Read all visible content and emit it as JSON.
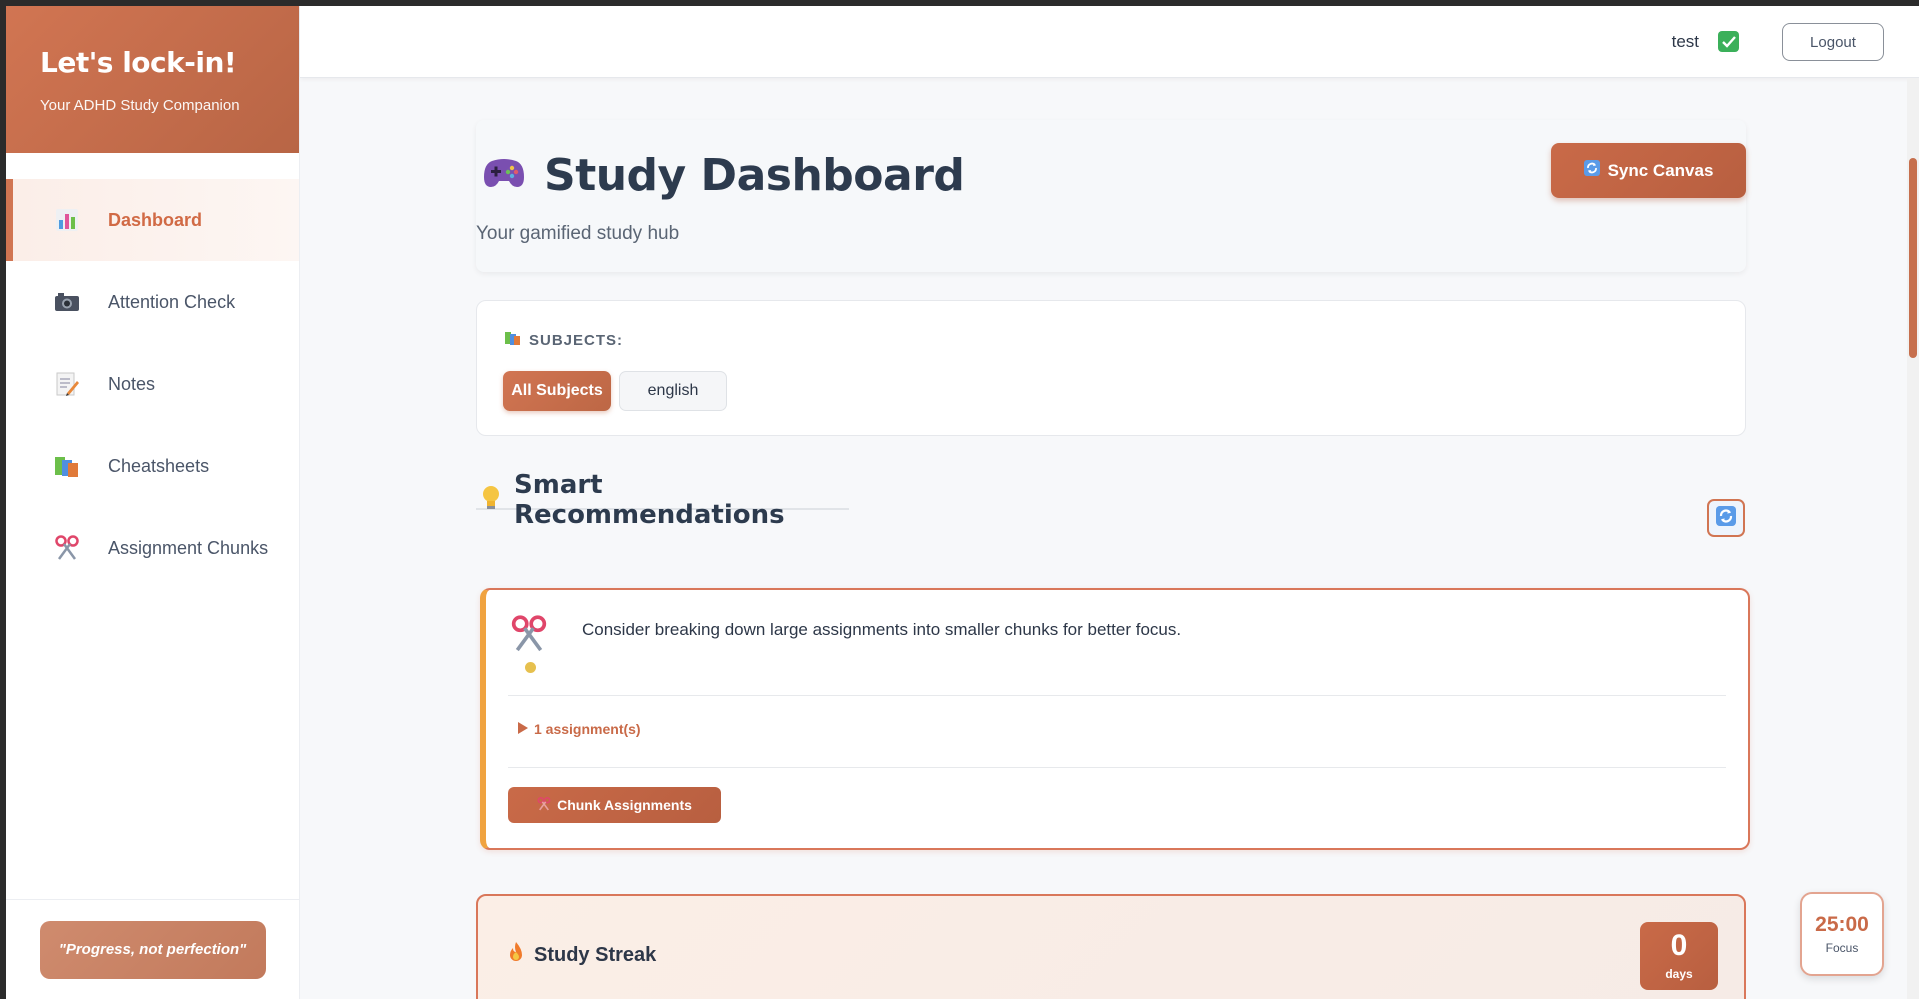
{
  "brand": {
    "title": "Let's lock-in!",
    "subtitle": "Your ADHD Study Companion"
  },
  "sidebar": {
    "items": [
      {
        "label": "Dashboard",
        "icon": "bar-chart-icon",
        "active": true
      },
      {
        "label": "Attention Check",
        "icon": "camera-icon",
        "active": false
      },
      {
        "label": "Notes",
        "icon": "memo-icon",
        "active": false
      },
      {
        "label": "Cheatsheets",
        "icon": "books-icon",
        "active": false
      },
      {
        "label": "Assignment Chunks",
        "icon": "scissors-icon",
        "active": false
      }
    ],
    "quote": "\"Progress, not perfection\""
  },
  "header": {
    "username": "test",
    "logout_label": "Logout"
  },
  "hero": {
    "title": "Study Dashboard",
    "subtitle": "Your gamified study hub",
    "sync_label": "Sync Canvas"
  },
  "subjects": {
    "label": "SUBJECTS:",
    "chips": [
      "All Subjects",
      "english"
    ],
    "selected": "All Subjects"
  },
  "recommendations": {
    "title": "Smart Recommendations",
    "cards": [
      {
        "text": "Consider breaking down large assignments into smaller chunks for better focus.",
        "toggle_label": "1 assignment(s)",
        "action_label": "Chunk Assignments"
      }
    ]
  },
  "streak": {
    "title": "Study Streak",
    "count": "0",
    "unit": "days"
  },
  "focus_timer": {
    "time": "25:00",
    "label": "Focus"
  },
  "colors": {
    "accent": "#d17552",
    "accent_dark": "#b85f40",
    "highlight": "#f0a340"
  }
}
